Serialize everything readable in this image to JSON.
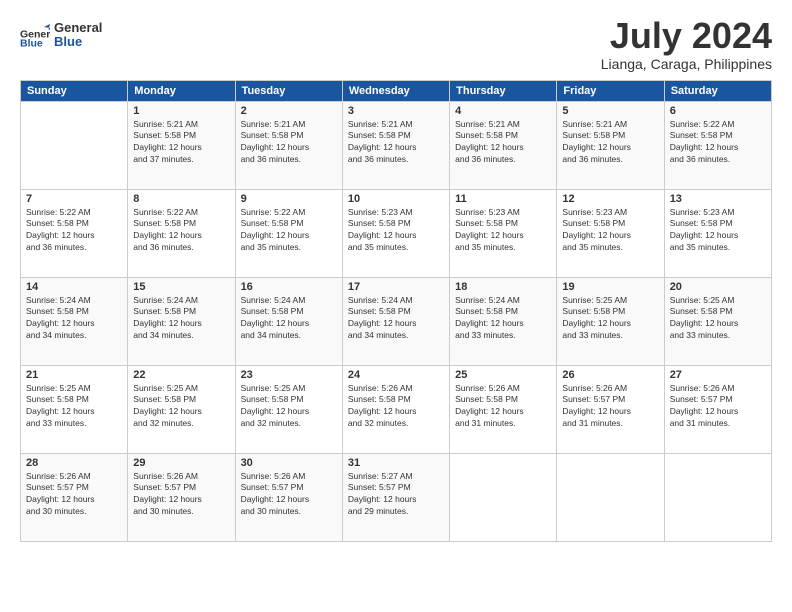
{
  "header": {
    "logo_general": "General",
    "logo_blue": "Blue",
    "title": "July 2024",
    "location": "Lianga, Caraga, Philippines"
  },
  "days_of_week": [
    "Sunday",
    "Monday",
    "Tuesday",
    "Wednesday",
    "Thursday",
    "Friday",
    "Saturday"
  ],
  "weeks": [
    [
      {
        "day": "",
        "info": ""
      },
      {
        "day": "1",
        "info": "Sunrise: 5:21 AM\nSunset: 5:58 PM\nDaylight: 12 hours\nand 37 minutes."
      },
      {
        "day": "2",
        "info": "Sunrise: 5:21 AM\nSunset: 5:58 PM\nDaylight: 12 hours\nand 36 minutes."
      },
      {
        "day": "3",
        "info": "Sunrise: 5:21 AM\nSunset: 5:58 PM\nDaylight: 12 hours\nand 36 minutes."
      },
      {
        "day": "4",
        "info": "Sunrise: 5:21 AM\nSunset: 5:58 PM\nDaylight: 12 hours\nand 36 minutes."
      },
      {
        "day": "5",
        "info": "Sunrise: 5:21 AM\nSunset: 5:58 PM\nDaylight: 12 hours\nand 36 minutes."
      },
      {
        "day": "6",
        "info": "Sunrise: 5:22 AM\nSunset: 5:58 PM\nDaylight: 12 hours\nand 36 minutes."
      }
    ],
    [
      {
        "day": "7",
        "info": "Sunrise: 5:22 AM\nSunset: 5:58 PM\nDaylight: 12 hours\nand 36 minutes."
      },
      {
        "day": "8",
        "info": "Sunrise: 5:22 AM\nSunset: 5:58 PM\nDaylight: 12 hours\nand 36 minutes."
      },
      {
        "day": "9",
        "info": "Sunrise: 5:22 AM\nSunset: 5:58 PM\nDaylight: 12 hours\nand 35 minutes."
      },
      {
        "day": "10",
        "info": "Sunrise: 5:23 AM\nSunset: 5:58 PM\nDaylight: 12 hours\nand 35 minutes."
      },
      {
        "day": "11",
        "info": "Sunrise: 5:23 AM\nSunset: 5:58 PM\nDaylight: 12 hours\nand 35 minutes."
      },
      {
        "day": "12",
        "info": "Sunrise: 5:23 AM\nSunset: 5:58 PM\nDaylight: 12 hours\nand 35 minutes."
      },
      {
        "day": "13",
        "info": "Sunrise: 5:23 AM\nSunset: 5:58 PM\nDaylight: 12 hours\nand 35 minutes."
      }
    ],
    [
      {
        "day": "14",
        "info": "Sunrise: 5:24 AM\nSunset: 5:58 PM\nDaylight: 12 hours\nand 34 minutes."
      },
      {
        "day": "15",
        "info": "Sunrise: 5:24 AM\nSunset: 5:58 PM\nDaylight: 12 hours\nand 34 minutes."
      },
      {
        "day": "16",
        "info": "Sunrise: 5:24 AM\nSunset: 5:58 PM\nDaylight: 12 hours\nand 34 minutes."
      },
      {
        "day": "17",
        "info": "Sunrise: 5:24 AM\nSunset: 5:58 PM\nDaylight: 12 hours\nand 34 minutes."
      },
      {
        "day": "18",
        "info": "Sunrise: 5:24 AM\nSunset: 5:58 PM\nDaylight: 12 hours\nand 33 minutes."
      },
      {
        "day": "19",
        "info": "Sunrise: 5:25 AM\nSunset: 5:58 PM\nDaylight: 12 hours\nand 33 minutes."
      },
      {
        "day": "20",
        "info": "Sunrise: 5:25 AM\nSunset: 5:58 PM\nDaylight: 12 hours\nand 33 minutes."
      }
    ],
    [
      {
        "day": "21",
        "info": "Sunrise: 5:25 AM\nSunset: 5:58 PM\nDaylight: 12 hours\nand 33 minutes."
      },
      {
        "day": "22",
        "info": "Sunrise: 5:25 AM\nSunset: 5:58 PM\nDaylight: 12 hours\nand 32 minutes."
      },
      {
        "day": "23",
        "info": "Sunrise: 5:25 AM\nSunset: 5:58 PM\nDaylight: 12 hours\nand 32 minutes."
      },
      {
        "day": "24",
        "info": "Sunrise: 5:26 AM\nSunset: 5:58 PM\nDaylight: 12 hours\nand 32 minutes."
      },
      {
        "day": "25",
        "info": "Sunrise: 5:26 AM\nSunset: 5:58 PM\nDaylight: 12 hours\nand 31 minutes."
      },
      {
        "day": "26",
        "info": "Sunrise: 5:26 AM\nSunset: 5:57 PM\nDaylight: 12 hours\nand 31 minutes."
      },
      {
        "day": "27",
        "info": "Sunrise: 5:26 AM\nSunset: 5:57 PM\nDaylight: 12 hours\nand 31 minutes."
      }
    ],
    [
      {
        "day": "28",
        "info": "Sunrise: 5:26 AM\nSunset: 5:57 PM\nDaylight: 12 hours\nand 30 minutes."
      },
      {
        "day": "29",
        "info": "Sunrise: 5:26 AM\nSunset: 5:57 PM\nDaylight: 12 hours\nand 30 minutes."
      },
      {
        "day": "30",
        "info": "Sunrise: 5:26 AM\nSunset: 5:57 PM\nDaylight: 12 hours\nand 30 minutes."
      },
      {
        "day": "31",
        "info": "Sunrise: 5:27 AM\nSunset: 5:57 PM\nDaylight: 12 hours\nand 29 minutes."
      },
      {
        "day": "",
        "info": ""
      },
      {
        "day": "",
        "info": ""
      },
      {
        "day": "",
        "info": ""
      }
    ]
  ]
}
